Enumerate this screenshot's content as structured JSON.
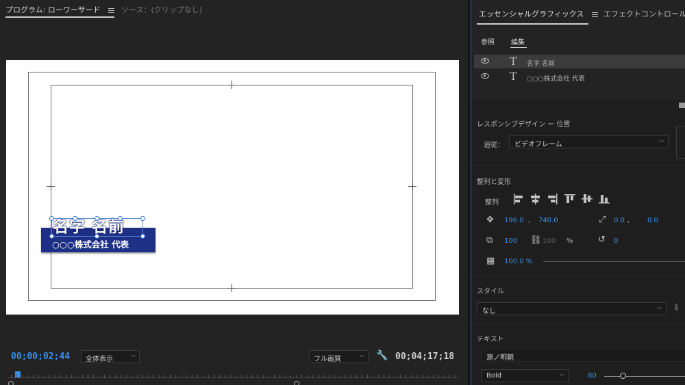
{
  "monitor": {
    "tabs": [
      {
        "label": "プログラム: ローワーサード"
      },
      {
        "label": "ソース：(クリップなし)"
      }
    ],
    "lower_third": {
      "name": "名字 名前",
      "company": "○○○株式会社 代表"
    },
    "current_timecode": "00;00;02;44",
    "zoom": "全体表示",
    "quality": "フル画質",
    "duration_timecode": "00;04;17;18"
  },
  "panel": {
    "tabs": [
      {
        "label": "エッセンシャルグラフィックス"
      },
      {
        "label": "エフェクトコントロール"
      }
    ],
    "subtabs": [
      {
        "label": "参照"
      },
      {
        "label": "編集"
      }
    ],
    "layers": [
      {
        "icon": "text-layer-icon",
        "name": "名字 名前"
      },
      {
        "icon": "text-layer-icon",
        "name": "○○○株式会社 代表"
      }
    ],
    "responsive": {
      "title": "レスポンシブデザイン ー 位置",
      "pin_label": "追従：",
      "pin_value": "ビデオフレーム"
    },
    "align": {
      "title": "整列と変形",
      "align_label": "整列",
      "position_x": "196.0",
      "position_y": "740.0",
      "comma": ",",
      "anchor_x": "0.0",
      "anchor_y": "0.0",
      "scale": "100",
      "scale_locked_value": "100",
      "percent": "%",
      "rotation": "0",
      "opacity": "100.0 %"
    },
    "style": {
      "title": "スタイル",
      "value": "なし"
    },
    "text": {
      "title": "テキスト",
      "font": "源ノ明朝",
      "weight": "Bold",
      "size": "80"
    }
  },
  "colors": {
    "accent_blue": "#3b8fe8",
    "lower_third_bar": "#1e2f86"
  }
}
